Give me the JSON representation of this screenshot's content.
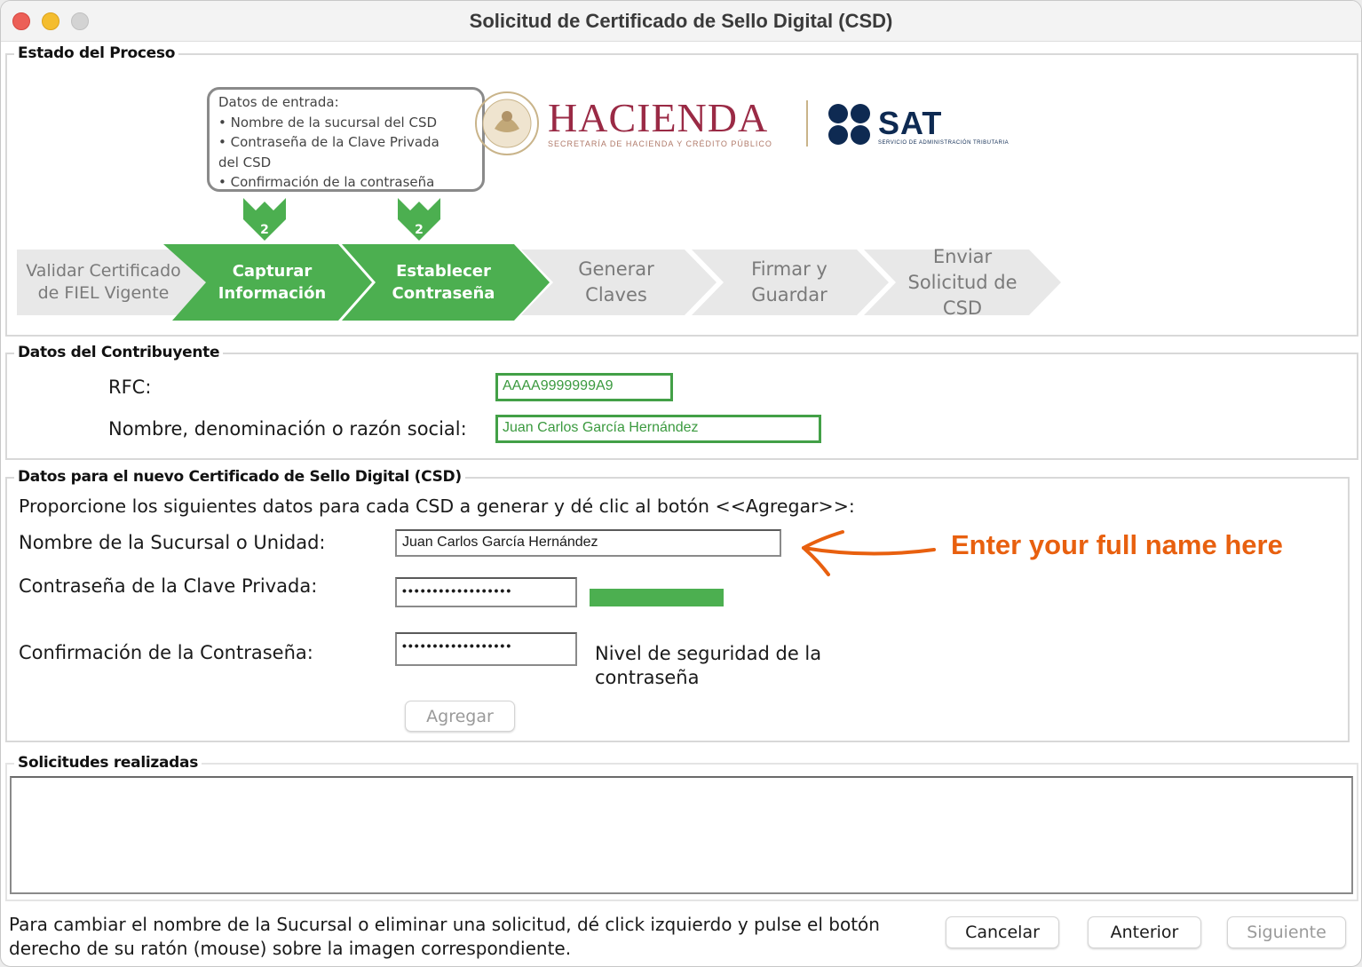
{
  "window": {
    "title": "Solicitud de Certificado de Sello Digital (CSD)"
  },
  "process": {
    "legend": "Estado del Proceso",
    "input_box": {
      "title": "Datos de entrada:",
      "lines": [
        "• Nombre de la sucursal del CSD",
        "• Contraseña de la Clave Privada",
        "del CSD",
        "• Confirmación de la contraseña"
      ]
    },
    "markers": [
      "2",
      "2"
    ],
    "steps": [
      {
        "line1": "Validar Certificado",
        "line2": "de FIEL Vigente",
        "state": "inactive"
      },
      {
        "line1": "Capturar",
        "line2": "Información",
        "state": "active"
      },
      {
        "line1": "Establecer",
        "line2": "Contraseña",
        "state": "active"
      },
      {
        "line1": "Generar",
        "line2": "Claves",
        "state": "inactive"
      },
      {
        "line1": "Firmar y",
        "line2": "Guardar",
        "state": "inactive"
      },
      {
        "line1": "Enviar",
        "line2": "Solicitud de",
        "line3": "CSD",
        "state": "inactive"
      }
    ],
    "logos": {
      "hacienda": "HACIENDA",
      "hacienda_sub": "SECRETARÍA DE HACIENDA Y CRÉDITO PÚBLICO",
      "sat": "SAT",
      "sat_sub": "SERVICIO DE ADMINISTRACIÓN TRIBUTARIA"
    }
  },
  "contribuyente": {
    "legend": "Datos del Contribuyente",
    "rfc_label": "RFC:",
    "rfc_value": "AAAA9999999A9",
    "nombre_label": "Nombre, denominación o razón social:",
    "nombre_value": "Juan Carlos García Hernández"
  },
  "csd": {
    "legend": "Datos para el nuevo Certificado de Sello Digital (CSD)",
    "instructions": "Proporcione los siguientes datos para cada CSD a generar y dé clic al botón <<Agregar>>:",
    "sucursal_label": "Nombre de la Sucursal o Unidad:",
    "sucursal_value": "Juan Carlos García Hernández",
    "password_label": "Contraseña de la Clave Privada:",
    "password_value": "••••••••••••••••••",
    "confirm_label": "Confirmación de la Contraseña:",
    "confirm_value": "••••••••••••••••••",
    "security_label_1": "Nivel de seguridad de la",
    "security_label_2": "contraseña",
    "strength_level": 1.0,
    "add_button": "Agregar",
    "annotation": "Enter your full name here"
  },
  "solicitudes": {
    "legend": "Solicitudes realizadas"
  },
  "footer": {
    "line1": "Para cambiar el nombre de la Sucursal o eliminar una solicitud, dé click izquierdo y pulse el botón",
    "line2": "derecho de su ratón (mouse) sobre la imagen correspondiente.",
    "cancel": "Cancelar",
    "back": "Anterior",
    "next": "Siguiente"
  },
  "colors": {
    "active_step": "#4caf50",
    "inactive_step": "#e8e8e8",
    "annotation": "#e8600f",
    "field_border": "#43a047"
  }
}
